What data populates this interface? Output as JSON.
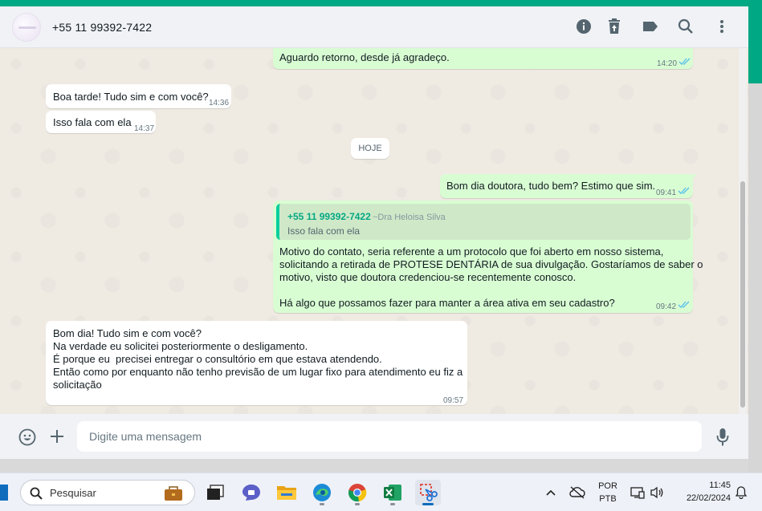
{
  "header": {
    "contact_name": "+55 11 99392-7422",
    "icons": [
      "info-icon",
      "delete-icon",
      "label-icon",
      "search-icon",
      "menu-icon"
    ]
  },
  "messages": [
    {
      "direction": "out",
      "text": "Aguardo retorno, desde já agradeço.",
      "time": "14:20",
      "ticks": "read"
    },
    {
      "direction": "in",
      "text": "Boa tarde! Tudo sim e com você?",
      "time": "14:36"
    },
    {
      "direction": "in",
      "text": "Isso fala com ela",
      "time": "14:37"
    },
    {
      "direction": "out",
      "text": "Bom dia doutora, tudo bem? Estimo que sim.",
      "time": "09:41",
      "ticks": "read"
    },
    {
      "direction": "out",
      "quote": {
        "author": "+55 11 99392-7422",
        "alias": "~Dra Heloisa Silva",
        "text": "Isso fala com ela"
      },
      "text": "Motivo do contato, seria referente a um protocolo que foi aberto em nosso sistema,\nsolicitando a retirada de PROTESE DENTÁRIA de sua divulgação. Gostaríamos de saber o\nmotivo, visto que doutora credenciou-se recentemente conosco.\n\nHá algo que possamos fazer para manter a área ativa em seu cadastro?",
      "time": "09:42",
      "ticks": "read"
    },
    {
      "direction": "in",
      "text": "Bom dia! Tudo sim e com você?\nNa verdade eu solicitei posteriormente o desligamento.\nÉ porque eu  precisei entregar o consultório em que estava atendendo.\nEntão como por enquanto não tenho previsão de um lugar fixo para atendimento eu fiz a\nsolicitação",
      "time": "09:57"
    }
  ],
  "date_chip": "HOJE",
  "composer": {
    "placeholder": "Digite uma mensagem",
    "icons": [
      "emoji-icon",
      "attach-plus-icon",
      "microphone-icon"
    ]
  },
  "colors": {
    "brand": "#00a884",
    "outgoing_bubble": "#d9fdd3",
    "incoming_bubble": "#ffffff",
    "chat_background": "#efeae2",
    "read_ticks": "#53bdeb"
  },
  "taskbar": {
    "search_label": "Pesquisar",
    "apps": [
      "work-briefcase-icon",
      "task-view-icon",
      "teams-chat-icon",
      "file-explorer-icon",
      "edge-icon",
      "chrome-icon",
      "excel-icon",
      "snipping-tool-icon"
    ],
    "language_line1": "POR",
    "language_line2": "PTB",
    "time": "11:45",
    "date": "22/02/2024"
  }
}
